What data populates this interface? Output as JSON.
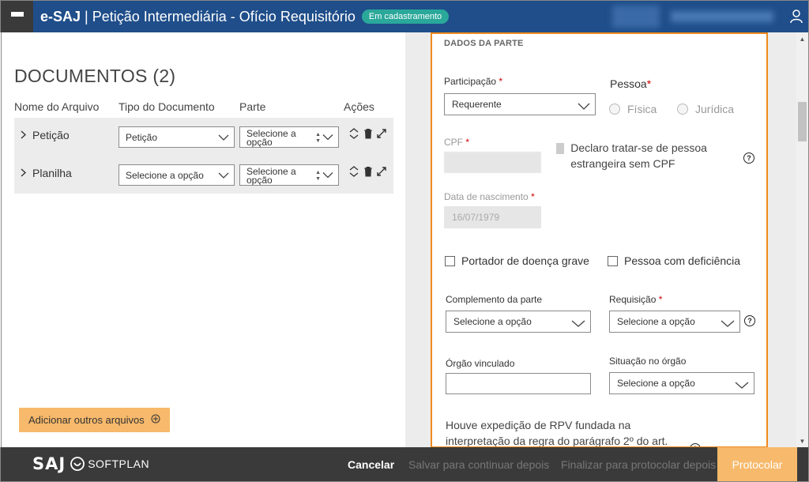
{
  "header": {
    "app": "e-SAJ",
    "title": "Petição Intermediária - Ofício Requisitório",
    "status": "Em cadastramento"
  },
  "documents": {
    "title": "DOCUMENTOS (2)",
    "columns": [
      "Nome do Arquivo",
      "Tipo do Documento",
      "Parte",
      "Ações"
    ],
    "rows": [
      {
        "name": "Petição",
        "type": "Petição",
        "part": "Selecione a opção"
      },
      {
        "name": "Planilha",
        "type": "Selecione a opção",
        "part": "Selecione a opção"
      }
    ],
    "add_button": "Adicionar outros arquivos"
  },
  "form": {
    "section_title": "DADOS DA PARTE",
    "participacao_label": "Participação",
    "participacao_value": "Requerente",
    "pessoa_label": "Pessoa",
    "pessoa_options": [
      "Física",
      "Jurídica"
    ],
    "cpf_label": "CPF",
    "foreign_label": "Declaro tratar-se de pessoa estrangeira sem CPF",
    "nascimento_label": "Data de nascimento",
    "nascimento_value": "16/07/1979",
    "doenca_label": "Portador de doença grave",
    "deficiencia_label": "Pessoa com deficiência",
    "complemento_label": "Complemento da parte",
    "complemento_value": "Selecione a opção",
    "requisicao_label": "Requisição",
    "requisicao_value": "Selecione a opção",
    "orgao_label": "Órgão vinculado",
    "situacao_label": "Situação no órgão",
    "situacao_value": "Selecione a opção",
    "rpv_text": "Houve expedição de RPV fundada na interpretação da regra do parágrafo 2º do art.",
    "required_mark": "*",
    "help_mark": "?"
  },
  "footer": {
    "logo_text": "SAJ",
    "brand": "SOFTPLAN",
    "cancel": "Cancelar",
    "save": "Salvar para continuar depois",
    "finish": "Finalizar para protocolar depois",
    "protocol": "Protocolar"
  },
  "colors": {
    "header_bg": "#1f4e8a",
    "accent_orange": "#f08a1c",
    "button_orange": "#f7b96b",
    "badge_teal": "#2aa89a",
    "footer_bg": "#3a3a3a"
  }
}
